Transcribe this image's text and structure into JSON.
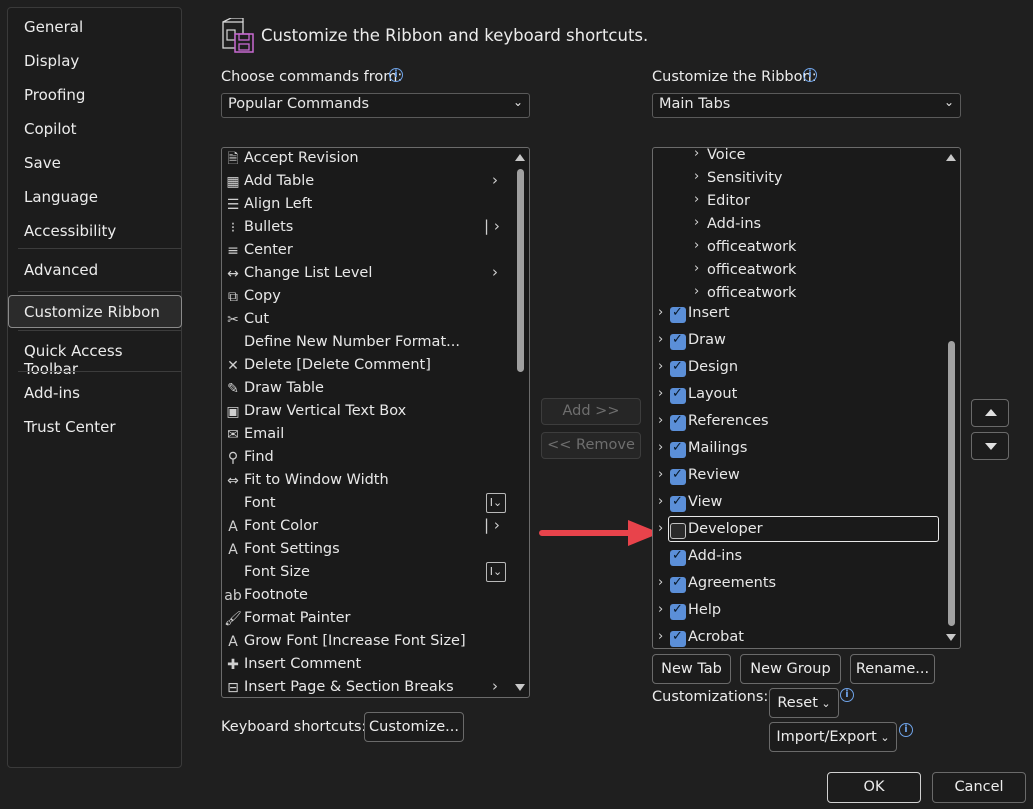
{
  "sidebar": {
    "items": [
      {
        "label": "General"
      },
      {
        "label": "Display"
      },
      {
        "label": "Proofing"
      },
      {
        "label": "Copilot"
      },
      {
        "label": "Save"
      },
      {
        "label": "Language"
      },
      {
        "label": "Accessibility"
      },
      {
        "label": "Advanced"
      },
      {
        "label": "Customize Ribbon",
        "selected": true
      },
      {
        "label": "Quick Access Toolbar"
      },
      {
        "label": "Add-ins"
      },
      {
        "label": "Trust Center"
      }
    ]
  },
  "header": {
    "title": "Customize the Ribbon and keyboard shortcuts."
  },
  "left": {
    "label": "Choose commands from:",
    "dropdown_value": "Popular Commands",
    "commands": [
      {
        "label": "Accept Revision",
        "icon": "accept-revision-icon"
      },
      {
        "label": "Add Table",
        "icon": "table-icon",
        "sub": "arrow"
      },
      {
        "label": "Align Left",
        "icon": "align-left-icon"
      },
      {
        "label": "Bullets",
        "icon": "bullets-icon",
        "sub": "split-arrow"
      },
      {
        "label": "Center",
        "icon": "align-center-icon"
      },
      {
        "label": "Change List Level",
        "icon": "list-level-icon",
        "sub": "arrow"
      },
      {
        "label": "Copy",
        "icon": "copy-icon"
      },
      {
        "label": "Cut",
        "icon": "scissors-icon"
      },
      {
        "label": "Define New Number Format...",
        "icon": ""
      },
      {
        "label": "Delete [Delete Comment]",
        "icon": "delete-comment-icon"
      },
      {
        "label": "Draw Table",
        "icon": "draw-table-icon"
      },
      {
        "label": "Draw Vertical Text Box",
        "icon": "text-box-icon"
      },
      {
        "label": "Email",
        "icon": "email-icon"
      },
      {
        "label": "Find",
        "icon": "search-icon"
      },
      {
        "label": "Fit to Window Width",
        "icon": "fit-width-icon"
      },
      {
        "label": "Font",
        "icon": "",
        "sub": "box"
      },
      {
        "label": "Font Color",
        "icon": "font-color-icon",
        "sub": "split-arrow"
      },
      {
        "label": "Font Settings",
        "icon": "font-settings-icon"
      },
      {
        "label": "Font Size",
        "icon": "",
        "sub": "box"
      },
      {
        "label": "Footnote",
        "icon": "footnote-icon"
      },
      {
        "label": "Format Painter",
        "icon": "format-painter-icon"
      },
      {
        "label": "Grow Font [Increase Font Size]",
        "icon": "grow-font-icon"
      },
      {
        "label": "Insert Comment",
        "icon": "insert-comment-icon"
      },
      {
        "label": "Insert Page & Section Breaks",
        "icon": "page-break-icon",
        "sub": "arrow"
      }
    ]
  },
  "middle": {
    "add_label": "Add >>",
    "remove_label": "<< Remove"
  },
  "right": {
    "label": "Customize the Ribbon:",
    "dropdown_value": "Main Tabs",
    "subitems": [
      "Voice",
      "Sensitivity",
      "Editor",
      "Add-ins",
      "officeatwork",
      "officeatwork",
      "officeatwork"
    ],
    "tabs": [
      {
        "label": "Insert",
        "checked": true,
        "expander": true
      },
      {
        "label": "Draw",
        "checked": true,
        "expander": true
      },
      {
        "label": "Design",
        "checked": true,
        "expander": true
      },
      {
        "label": "Layout",
        "checked": true,
        "expander": true
      },
      {
        "label": "References",
        "checked": true,
        "expander": true
      },
      {
        "label": "Mailings",
        "checked": true,
        "expander": true
      },
      {
        "label": "Review",
        "checked": true,
        "expander": true
      },
      {
        "label": "View",
        "checked": true,
        "expander": true
      },
      {
        "label": "Developer",
        "checked": false,
        "expander": true,
        "focused": true
      },
      {
        "label": "Add-ins",
        "checked": true,
        "expander": false
      },
      {
        "label": "Agreements",
        "checked": true,
        "expander": true
      },
      {
        "label": "Help",
        "checked": true,
        "expander": true
      },
      {
        "label": "Acrobat",
        "checked": true,
        "expander": true
      }
    ],
    "new_tab_label": "New Tab",
    "new_group_label": "New Group",
    "rename_label": "Rename...",
    "customizations_label": "Customizations:",
    "reset_label": "Reset",
    "import_export_label": "Import/Export"
  },
  "keyboard": {
    "label": "Keyboard shortcuts:",
    "customize_label": "Customize..."
  },
  "footer": {
    "ok_label": "OK",
    "cancel_label": "Cancel"
  },
  "colors": {
    "accent": "#5b8fd8",
    "arrow": "#e8434b"
  }
}
